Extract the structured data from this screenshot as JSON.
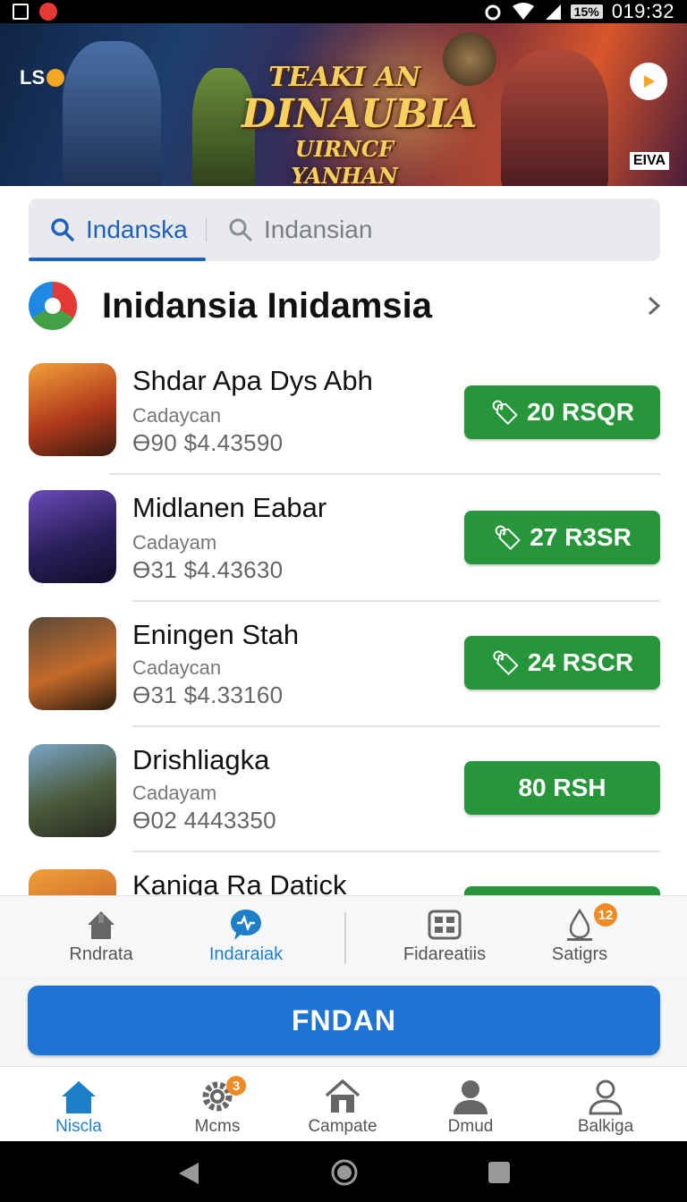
{
  "status_bar": {
    "time": "019:32",
    "battery": "15%"
  },
  "banner": {
    "logo": "LS",
    "title_line1": "TEAKI AN",
    "title_line2": "DINAUBIA",
    "title_line3": "UIRNCF YANHAN",
    "badge": "EIVA"
  },
  "search_tabs": [
    {
      "label": "Indanska",
      "icon": "search-icon",
      "active": true
    },
    {
      "label": "Indansian",
      "icon": "search-icon",
      "active": false
    }
  ],
  "section": {
    "title": "Inidansia Inidamsia"
  },
  "items": [
    {
      "name": "Shdar Apa Dys Abh",
      "sub": "Cadaycan",
      "price": "Ɵ90  $4.43590",
      "button": "20 RSQR",
      "button_icon": "tag-icon"
    },
    {
      "name": "Midlanen Eabar",
      "sub": "Cadayam",
      "price": "Ɵ31  $4.43630",
      "button": "27 R3SR",
      "button_icon": "tag-icon"
    },
    {
      "name": "Eningen Stah",
      "sub": "Cadaycan",
      "price": "Ɵ31  $4.33160",
      "button": "24 RSCR",
      "button_icon": "tag-icon"
    },
    {
      "name": "Drishliagka",
      "sub": "Cadayam",
      "price": "Ɵ02  4443350",
      "button": "80 RSH",
      "button_icon": ""
    },
    {
      "name": "Kaniga Ra Datick",
      "sub": "",
      "price": "",
      "button": "",
      "button_icon": ""
    }
  ],
  "sub_nav": [
    {
      "label": "Rndrata",
      "icon": "home-icon",
      "active": false
    },
    {
      "label": "Indaraiak",
      "icon": "chat-icon",
      "active": true
    },
    {
      "label": "Fidareatiis",
      "icon": "grid-icon",
      "active": false
    },
    {
      "label": "Satigrs",
      "icon": "drop-icon",
      "active": false,
      "badge": "12"
    }
  ],
  "primary_button": "FNDAN",
  "bottom_nav": [
    {
      "label": "Niscla",
      "icon": "home-icon",
      "active": true
    },
    {
      "label": "Mcms",
      "icon": "gear-icon",
      "active": false,
      "badge": "3"
    },
    {
      "label": "Campate",
      "icon": "house-outline-icon",
      "active": false
    },
    {
      "label": "Dmud",
      "icon": "user-icon",
      "active": false
    },
    {
      "label": "Balkiga",
      "icon": "user-outline-icon",
      "active": false
    }
  ],
  "colors": {
    "accent": "#1e7fc8",
    "buy_button": "#27963a",
    "primary_button": "#1f73d2"
  }
}
